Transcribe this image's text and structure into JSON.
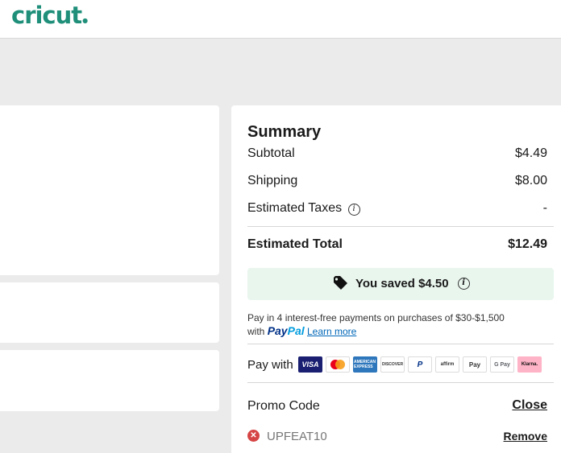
{
  "header": {
    "logo_text": "cricut",
    "brand_color": "#1f8f7a"
  },
  "summary": {
    "title": "Summary",
    "subtotal_label": "Subtotal",
    "subtotal_value": "$4.49",
    "shipping_label": "Shipping",
    "shipping_value": "$8.00",
    "taxes_label": "Estimated Taxes",
    "taxes_value": "-",
    "total_label": "Estimated Total",
    "total_value": "$12.49",
    "saved_text": "You saved $4.50",
    "saved_bg_color": "#e9f6ee"
  },
  "paypal": {
    "line1": "Pay in 4 interest-free payments on purchases of $30-$1,500",
    "with_text": "with",
    "logo_pay": "Pay",
    "logo_pal": "Pal",
    "learn_more": "Learn more"
  },
  "pay_with": {
    "label": "Pay with",
    "icons": [
      {
        "name": "visa-icon",
        "text": "VISA"
      },
      {
        "name": "mastercard-icon",
        "text": ""
      },
      {
        "name": "amex-icon",
        "text": "AMERICAN EXPRESS"
      },
      {
        "name": "discover-icon",
        "text": "DISCOVER"
      },
      {
        "name": "paypal-icon",
        "text": "P"
      },
      {
        "name": "affirm-icon",
        "text": "affirm"
      },
      {
        "name": "apple-pay-icon",
        "text": "Pay"
      },
      {
        "name": "google-pay-icon",
        "text": "G Pay"
      },
      {
        "name": "klarna-icon",
        "text": "Klarna."
      }
    ]
  },
  "promo": {
    "label": "Promo Code",
    "close_label": "Close",
    "code": "UPFEAT10",
    "remove_label": "Remove"
  }
}
